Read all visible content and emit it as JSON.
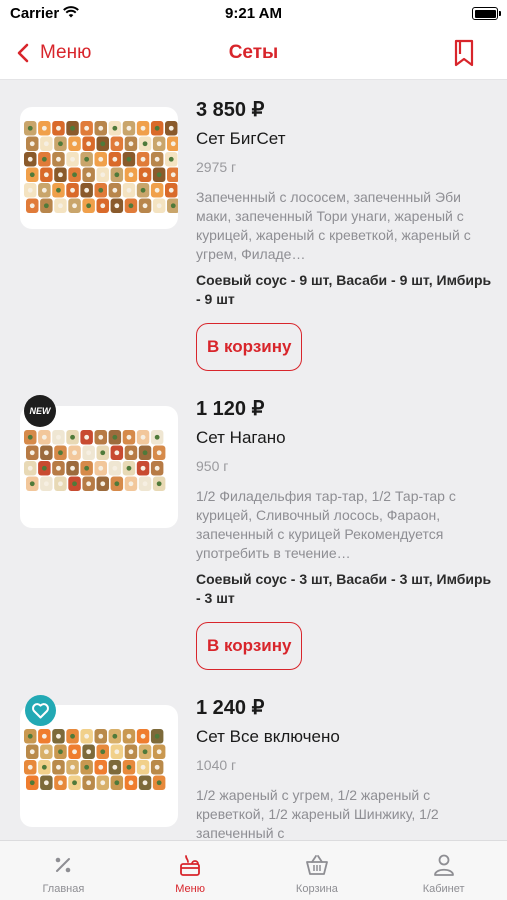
{
  "status_bar": {
    "carrier": "Carrier",
    "time": "9:21 AM"
  },
  "nav": {
    "back_label": "Меню",
    "title": "Сеты",
    "bookmark_icon": "bookmark-icon",
    "accent": "#d8252b"
  },
  "products": [
    {
      "price": "3 850 ₽",
      "title": "Сет БигСет",
      "weight": "2975 г",
      "description": "Запеченный с лососем, запеченный Эби маки, запеченный Тори унаги, жареный с курицей, жареный с креветкой, жареный с угрем, Филаде…",
      "extras": "Соевый соус - 9 шт, Васаби - 9 шт, Имбирь - 9 шт",
      "cart_label": "В корзину",
      "badge": null
    },
    {
      "price": "1 120 ₽",
      "title": "Сет Нагано",
      "weight": "950 г",
      "description": "1/2 Филадельфия тар-тар, 1/2 Тар-тар с курицей, Сливочный лосось, Фараон, запеченный с курицей Рекомендуется употребить в течение…",
      "extras": "Соевый соус - 3 шт, Васаби - 3 шт, Имбирь - 3 шт",
      "cart_label": "В корзину",
      "badge": "NEW"
    },
    {
      "price": "1 240 ₽",
      "title": "Сет Все включено",
      "weight": "1040 г",
      "description": "1/2 жареный с угрем, 1/2 жареный с креветкой, 1/2 жареный Шинжику, 1/2 запеченный с",
      "extras": "",
      "cart_label": "",
      "badge": "heart-icon"
    }
  ],
  "tabs": [
    {
      "label": "Главная",
      "icon": "percent-tag-icon",
      "active": false
    },
    {
      "label": "Меню",
      "icon": "chef-hat-menu-icon",
      "active": true
    },
    {
      "label": "Корзина",
      "icon": "basket-icon",
      "active": false
    },
    {
      "label": "Кабинет",
      "icon": "user-icon",
      "active": false
    }
  ]
}
